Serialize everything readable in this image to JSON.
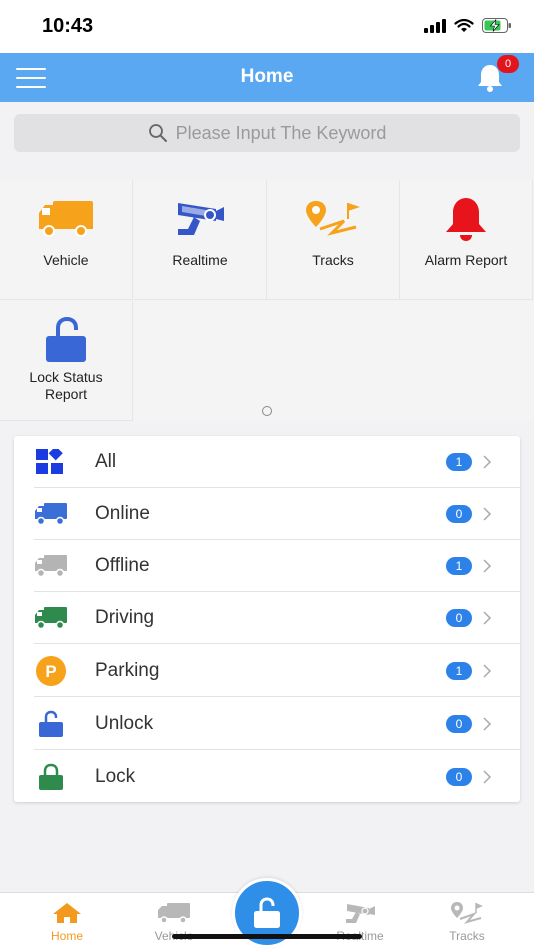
{
  "status": {
    "time": "10:43"
  },
  "header": {
    "title": "Home",
    "notification_count": "0"
  },
  "search": {
    "placeholder": "Please Input The Keyword"
  },
  "grid": [
    {
      "label": "Vehicle",
      "icon": "truck-icon",
      "color": "#f7a21b"
    },
    {
      "label": "Realtime",
      "icon": "camera-icon",
      "color": "#3556c9"
    },
    {
      "label": "Tracks",
      "icon": "route-icon",
      "color": "#f7a21b"
    },
    {
      "label": "Alarm Report",
      "icon": "alarm-bell-icon",
      "color": "#e8141b"
    },
    {
      "label": "Lock Status\nReport",
      "icon": "unlock-icon",
      "color": "#3a67d6"
    }
  ],
  "list": [
    {
      "label": "All",
      "count": "1",
      "icon": "grid-icon",
      "color": "#1a3ce0"
    },
    {
      "label": "Online",
      "count": "0",
      "icon": "truck-icon",
      "color": "#3b6fd8"
    },
    {
      "label": "Offline",
      "count": "1",
      "icon": "truck-icon",
      "color": "#b4b4b4"
    },
    {
      "label": "Driving",
      "count": "0",
      "icon": "truck-icon",
      "color": "#2e8b4d"
    },
    {
      "label": "Parking",
      "count": "1",
      "icon": "parking-icon",
      "color": "#f7a21b"
    },
    {
      "label": "Unlock",
      "count": "0",
      "icon": "unlock-icon",
      "color": "#3a67d6"
    },
    {
      "label": "Lock",
      "count": "0",
      "icon": "lock-icon",
      "color": "#2e8b4d"
    }
  ],
  "tabs": [
    {
      "label": "Home",
      "icon": "home-icon",
      "active": true
    },
    {
      "label": "Vehicle",
      "icon": "truck-icon",
      "active": false
    },
    {
      "label": "Realtime",
      "icon": "camera-icon",
      "active": false
    },
    {
      "label": "Tracks",
      "icon": "route-icon",
      "active": false
    }
  ],
  "colors": {
    "header": "#5aa8f2",
    "accent": "#2c82e8",
    "active_tab": "#f39a1e"
  }
}
